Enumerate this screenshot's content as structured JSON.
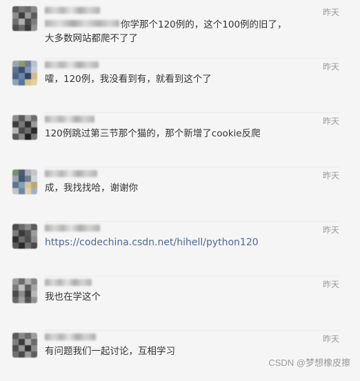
{
  "comments": [
    {
      "text_line1": "你学那个120例的，这个100例的旧了，",
      "text_line2": "大多数网站都爬不了了",
      "time": "昨天"
    },
    {
      "text": "嚯，120例，我没看到有，就看到这个了",
      "time": "昨天"
    },
    {
      "text": "120例跳过第三节那个猫的，那个新增了cookie反爬",
      "time": "昨天"
    },
    {
      "text": "成，我找找哈，谢谢你",
      "time": "昨天"
    },
    {
      "link": "https://codechina.csdn.net/hihell/python120",
      "time": "昨天"
    },
    {
      "text": "我也在学这个",
      "time": "昨天"
    },
    {
      "text": "有问题我们一起讨论，互相学习",
      "time": "昨天"
    }
  ],
  "watermark": "CSDN @梦想橡皮擦",
  "colors": {
    "background": "#f5f5f5",
    "text": "#333333",
    "time": "#999999",
    "link": "#4a6a9a",
    "divider": "#ebebeb"
  }
}
